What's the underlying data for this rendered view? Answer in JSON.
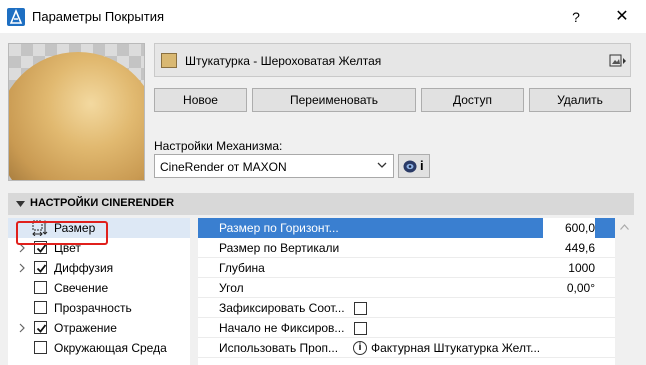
{
  "window": {
    "title": "Параметры Покрытия",
    "help_label": "?",
    "close_label": "✕"
  },
  "surface": {
    "name": "Штукатурка - Шероховатая Желтая",
    "swatch_color": "#d9b872"
  },
  "buttons": {
    "new": "Новое",
    "rename": "Переименовать",
    "access": "Доступ",
    "delete": "Удалить"
  },
  "engine": {
    "label": "Настройки Механизма:",
    "value": "CineRender от MAXON",
    "info_label": "i"
  },
  "section": {
    "title": "НАСТРОЙКИ CINERENDER"
  },
  "channels": [
    {
      "label": "Размер",
      "selected": true,
      "has_check": false,
      "expandable": false
    },
    {
      "label": "Цвет",
      "checked": true,
      "expandable": true
    },
    {
      "label": "Диффузия",
      "checked": true,
      "expandable": true
    },
    {
      "label": "Свечение",
      "checked": false,
      "expandable": false
    },
    {
      "label": "Прозрачность",
      "checked": false,
      "expandable": false
    },
    {
      "label": "Отражение",
      "checked": true,
      "expandable": true
    },
    {
      "label": "Окружающая Среда",
      "checked": false,
      "expandable": false
    }
  ],
  "properties": [
    {
      "label": "Размер по Горизонт...",
      "value": "600,0",
      "active": true
    },
    {
      "label": "Размер по Вертикали",
      "value": "449,6"
    },
    {
      "label": "Глубина",
      "value": "1000"
    },
    {
      "label": "Угол",
      "value": "0,00°"
    },
    {
      "label": "Зафиксировать Соот...",
      "checkbox": true,
      "checked": false
    },
    {
      "label": "Начало не Фиксиров...",
      "checkbox": true,
      "checked": false
    },
    {
      "label": "Использовать Проп...",
      "linked": "Фактурная Штукатурка Желт...",
      "info_icon": "i"
    }
  ],
  "colors": {
    "selection_blue": "#3a7fd0",
    "highlight_red": "#e0201c"
  }
}
